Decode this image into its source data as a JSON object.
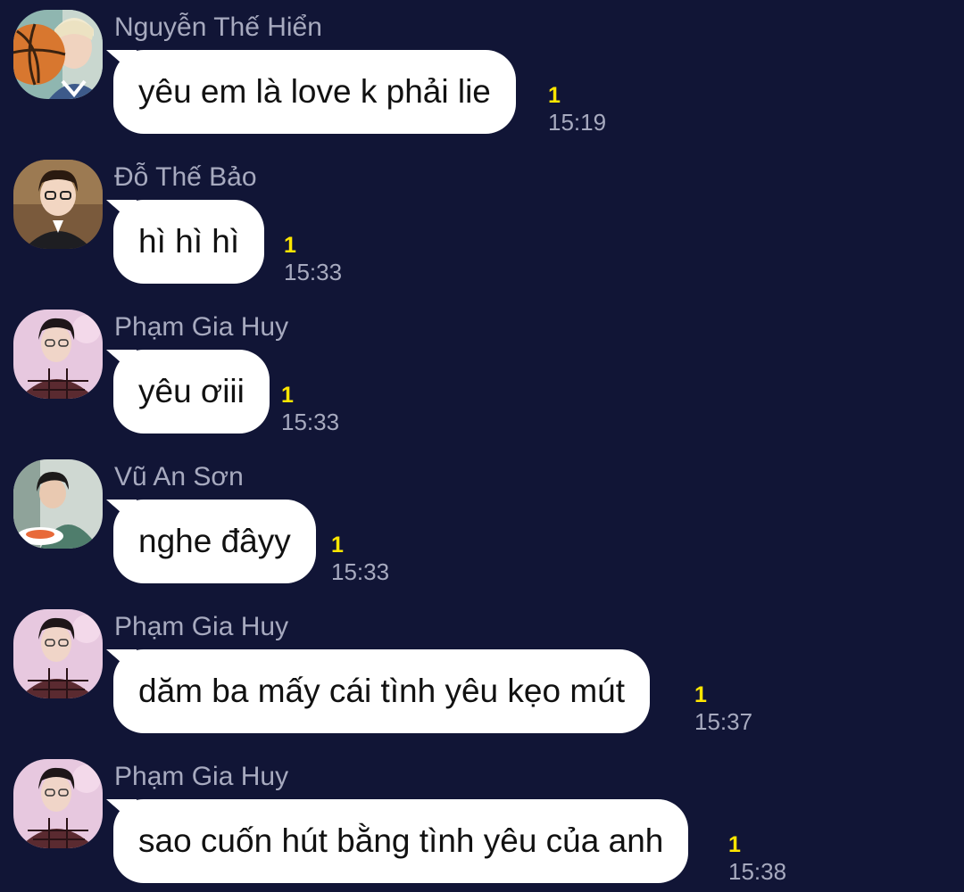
{
  "messages": [
    {
      "sender": "Nguyễn Thế Hiển",
      "text": "yêu em là love k phải lie",
      "unread": "1",
      "time": "15:19",
      "avatar_icon": "basketball-avatar-icon"
    },
    {
      "sender": "Đỗ Thế Bảo",
      "text": "hì hì hì",
      "unread": "1",
      "time": "15:33",
      "avatar_icon": "glasses-boy-avatar-icon"
    },
    {
      "sender": "Phạm Gia Huy",
      "text": "yêu ơiii",
      "unread": "1",
      "time": "15:33",
      "avatar_icon": "plaid-shirt-avatar-icon"
    },
    {
      "sender": "Vũ An Sơn",
      "text": "nghe đâyy",
      "unread": "1",
      "time": "15:33",
      "avatar_icon": "eating-avatar-icon"
    },
    {
      "sender": "Phạm Gia Huy",
      "text": "dăm ba mấy cái tình yêu kẹo mút",
      "unread": "1",
      "time": "15:37",
      "avatar_icon": "plaid-shirt-avatar-icon"
    },
    {
      "sender": "Phạm Gia Huy",
      "text": "sao cuốn hút bằng tình yêu của anh",
      "unread": "1",
      "time": "15:38",
      "avatar_icon": "plaid-shirt-avatar-icon"
    }
  ],
  "colors": {
    "background": "#111536",
    "bubble": "#ffffff",
    "unread": "#ffe600",
    "meta_text": "#a7aabf"
  }
}
